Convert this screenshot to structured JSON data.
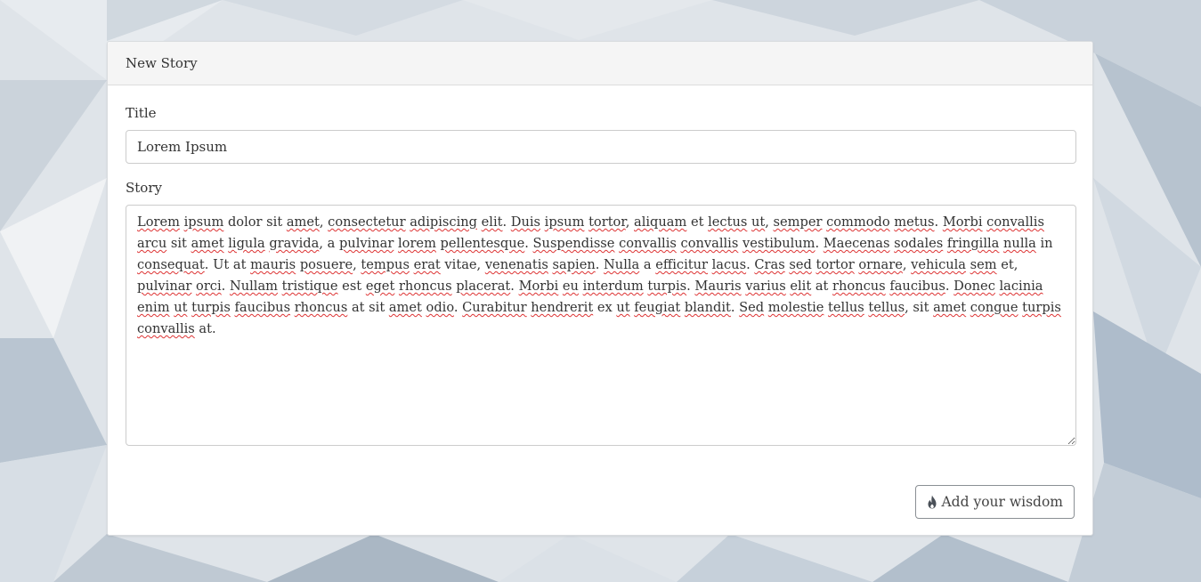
{
  "panel": {
    "heading": "New Story"
  },
  "form": {
    "title_label": "Title",
    "title_value": "Lorem Ipsum",
    "story_label": "Story",
    "story_segments": [
      {
        "t": "Lorem",
        "s": true
      },
      {
        "t": " ",
        "s": false
      },
      {
        "t": "ipsum",
        "s": true
      },
      {
        "t": " dolor sit ",
        "s": false
      },
      {
        "t": "amet",
        "s": true
      },
      {
        "t": ", ",
        "s": false
      },
      {
        "t": "consectetur",
        "s": true
      },
      {
        "t": " ",
        "s": false
      },
      {
        "t": "adipiscing",
        "s": true
      },
      {
        "t": " ",
        "s": false
      },
      {
        "t": "elit",
        "s": true
      },
      {
        "t": ". ",
        "s": false
      },
      {
        "t": "Duis",
        "s": true
      },
      {
        "t": " ",
        "s": false
      },
      {
        "t": "ipsum",
        "s": true
      },
      {
        "t": " ",
        "s": false
      },
      {
        "t": "tortor",
        "s": true
      },
      {
        "t": ", ",
        "s": false
      },
      {
        "t": "aliquam",
        "s": true
      },
      {
        "t": " et ",
        "s": false
      },
      {
        "t": "lectus",
        "s": true
      },
      {
        "t": " ",
        "s": false
      },
      {
        "t": "ut",
        "s": true
      },
      {
        "t": ", ",
        "s": false
      },
      {
        "t": "semper",
        "s": true
      },
      {
        "t": " ",
        "s": false
      },
      {
        "t": "commodo",
        "s": true
      },
      {
        "t": " ",
        "s": false
      },
      {
        "t": "metus",
        "s": true
      },
      {
        "t": ". ",
        "s": false
      },
      {
        "t": "Morbi",
        "s": true
      },
      {
        "t": " ",
        "s": false
      },
      {
        "t": "convallis",
        "s": true
      },
      {
        "t": " ",
        "s": false
      },
      {
        "t": "arcu",
        "s": true
      },
      {
        "t": " sit ",
        "s": false
      },
      {
        "t": "amet",
        "s": true
      },
      {
        "t": " ",
        "s": false
      },
      {
        "t": "ligula",
        "s": true
      },
      {
        "t": " ",
        "s": false
      },
      {
        "t": "gravida",
        "s": true
      },
      {
        "t": ", a ",
        "s": false
      },
      {
        "t": "pulvinar",
        "s": true
      },
      {
        "t": " ",
        "s": false
      },
      {
        "t": "lorem",
        "s": true
      },
      {
        "t": " ",
        "s": false
      },
      {
        "t": "pellentesque",
        "s": true
      },
      {
        "t": ". ",
        "s": false
      },
      {
        "t": "Suspendisse",
        "s": true
      },
      {
        "t": " ",
        "s": false
      },
      {
        "t": "convallis",
        "s": true
      },
      {
        "t": " ",
        "s": false
      },
      {
        "t": "convallis",
        "s": true
      },
      {
        "t": " ",
        "s": false
      },
      {
        "t": "vestibulum",
        "s": true
      },
      {
        "t": ". ",
        "s": false
      },
      {
        "t": "Maecenas",
        "s": true
      },
      {
        "t": " ",
        "s": false
      },
      {
        "t": "sodales",
        "s": true
      },
      {
        "t": " ",
        "s": false
      },
      {
        "t": "fringilla",
        "s": true
      },
      {
        "t": " ",
        "s": false
      },
      {
        "t": "nulla",
        "s": true
      },
      {
        "t": " in ",
        "s": false
      },
      {
        "t": "consequat",
        "s": true
      },
      {
        "t": ". Ut at ",
        "s": false
      },
      {
        "t": "mauris",
        "s": true
      },
      {
        "t": " ",
        "s": false
      },
      {
        "t": "posuere",
        "s": true
      },
      {
        "t": ", ",
        "s": false
      },
      {
        "t": "tempus",
        "s": true
      },
      {
        "t": " ",
        "s": false
      },
      {
        "t": "erat",
        "s": true
      },
      {
        "t": " vitae, ",
        "s": false
      },
      {
        "t": "venenatis",
        "s": true
      },
      {
        "t": " ",
        "s": false
      },
      {
        "t": "sapien",
        "s": true
      },
      {
        "t": ". ",
        "s": false
      },
      {
        "t": "Nulla",
        "s": true
      },
      {
        "t": " a ",
        "s": false
      },
      {
        "t": "efficitur",
        "s": true
      },
      {
        "t": " ",
        "s": false
      },
      {
        "t": "lacus",
        "s": true
      },
      {
        "t": ". ",
        "s": false
      },
      {
        "t": "Cras",
        "s": true
      },
      {
        "t": " ",
        "s": false
      },
      {
        "t": "sed",
        "s": true
      },
      {
        "t": " ",
        "s": false
      },
      {
        "t": "tortor",
        "s": true
      },
      {
        "t": " ",
        "s": false
      },
      {
        "t": "ornare",
        "s": true
      },
      {
        "t": ", ",
        "s": false
      },
      {
        "t": "vehicula",
        "s": true
      },
      {
        "t": " ",
        "s": false
      },
      {
        "t": "sem",
        "s": true
      },
      {
        "t": " et, ",
        "s": false
      },
      {
        "t": "pulvinar",
        "s": true
      },
      {
        "t": " ",
        "s": false
      },
      {
        "t": "orci",
        "s": true
      },
      {
        "t": ". ",
        "s": false
      },
      {
        "t": "Nullam",
        "s": true
      },
      {
        "t": " ",
        "s": false
      },
      {
        "t": "tristique",
        "s": true
      },
      {
        "t": " est ",
        "s": false
      },
      {
        "t": "eget",
        "s": true
      },
      {
        "t": " ",
        "s": false
      },
      {
        "t": "rhoncus",
        "s": true
      },
      {
        "t": " ",
        "s": false
      },
      {
        "t": "placerat",
        "s": true
      },
      {
        "t": ". ",
        "s": false
      },
      {
        "t": "Morbi",
        "s": true
      },
      {
        "t": " ",
        "s": false
      },
      {
        "t": "eu",
        "s": true
      },
      {
        "t": " ",
        "s": false
      },
      {
        "t": "interdum",
        "s": true
      },
      {
        "t": " ",
        "s": false
      },
      {
        "t": "turpis",
        "s": true
      },
      {
        "t": ". ",
        "s": false
      },
      {
        "t": "Mauris",
        "s": true
      },
      {
        "t": " ",
        "s": false
      },
      {
        "t": "varius",
        "s": true
      },
      {
        "t": " ",
        "s": false
      },
      {
        "t": "elit",
        "s": true
      },
      {
        "t": " at ",
        "s": false
      },
      {
        "t": "rhoncus",
        "s": true
      },
      {
        "t": " ",
        "s": false
      },
      {
        "t": "faucibus",
        "s": true
      },
      {
        "t": ". ",
        "s": false
      },
      {
        "t": "Donec",
        "s": true
      },
      {
        "t": " ",
        "s": false
      },
      {
        "t": "lacinia",
        "s": true
      },
      {
        "t": " ",
        "s": false
      },
      {
        "t": "enim",
        "s": true
      },
      {
        "t": " ",
        "s": false
      },
      {
        "t": "ut",
        "s": true
      },
      {
        "t": " ",
        "s": false
      },
      {
        "t": "turpis",
        "s": true
      },
      {
        "t": " ",
        "s": false
      },
      {
        "t": "faucibus",
        "s": true
      },
      {
        "t": " ",
        "s": false
      },
      {
        "t": "rhoncus",
        "s": true
      },
      {
        "t": " at sit ",
        "s": false
      },
      {
        "t": "amet",
        "s": true
      },
      {
        "t": " ",
        "s": false
      },
      {
        "t": "odio",
        "s": true
      },
      {
        "t": ". ",
        "s": false
      },
      {
        "t": "Curabitur",
        "s": true
      },
      {
        "t": " ",
        "s": false
      },
      {
        "t": "hendrerit",
        "s": true
      },
      {
        "t": " ex ",
        "s": false
      },
      {
        "t": "ut",
        "s": true
      },
      {
        "t": " ",
        "s": false
      },
      {
        "t": "feugiat",
        "s": true
      },
      {
        "t": " ",
        "s": false
      },
      {
        "t": "blandit",
        "s": true
      },
      {
        "t": ". ",
        "s": false
      },
      {
        "t": "Sed",
        "s": true
      },
      {
        "t": " ",
        "s": false
      },
      {
        "t": "molestie",
        "s": true
      },
      {
        "t": " ",
        "s": false
      },
      {
        "t": "tellus",
        "s": true
      },
      {
        "t": " ",
        "s": false
      },
      {
        "t": "tellus",
        "s": true
      },
      {
        "t": ", sit ",
        "s": false
      },
      {
        "t": "amet",
        "s": true
      },
      {
        "t": " ",
        "s": false
      },
      {
        "t": "congue",
        "s": true
      },
      {
        "t": " ",
        "s": false
      },
      {
        "t": "turpis",
        "s": true
      },
      {
        "t": " ",
        "s": false
      },
      {
        "t": "convallis",
        "s": true
      },
      {
        "t": " at.",
        "s": false
      }
    ]
  },
  "actions": {
    "submit_label": "Add your wisdom",
    "submit_icon": "flame-icon"
  },
  "colors": {
    "spellcheck_underline": "#d33",
    "heading_bg": "#f5f5f5",
    "text": "#333333"
  }
}
